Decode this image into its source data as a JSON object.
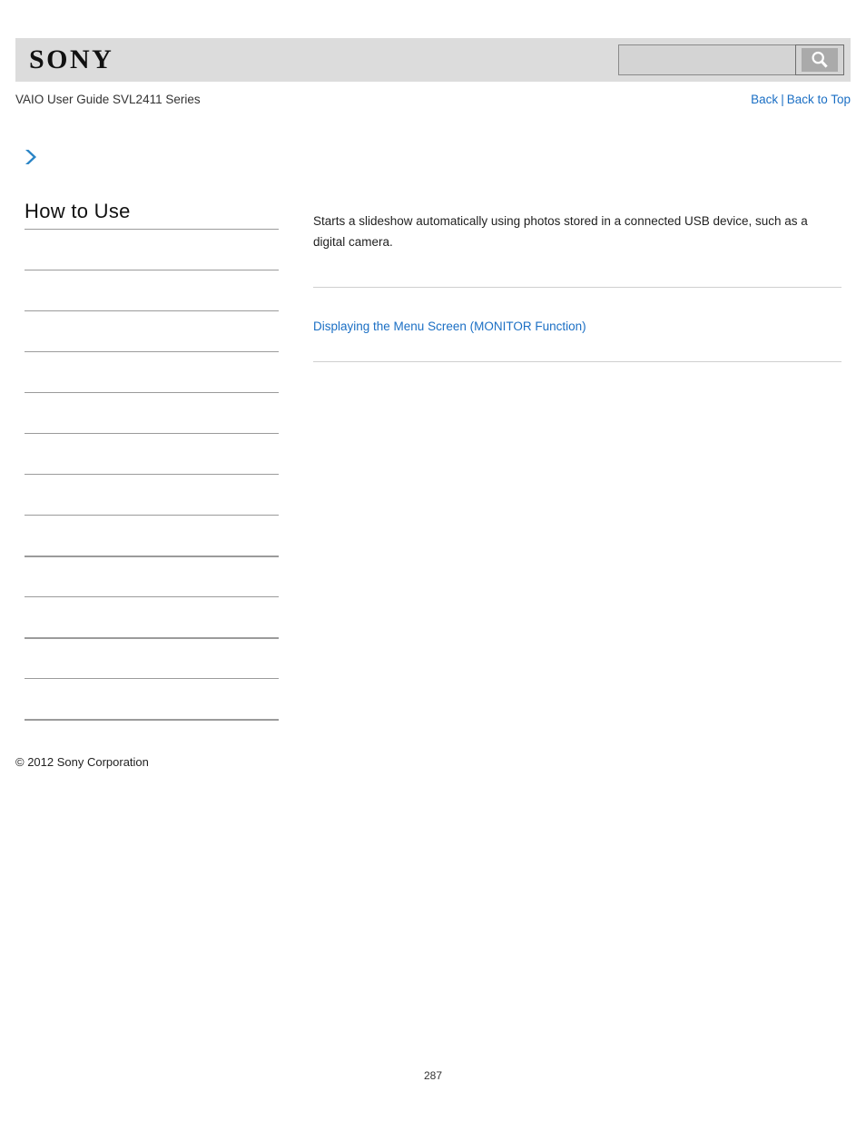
{
  "header": {
    "logo_text": "SONY",
    "logo_icon": "sony-wordmark",
    "search": {
      "value": "",
      "placeholder": "",
      "button_icon": "search-icon",
      "button_label": ""
    },
    "band_color": "#dcdcdc"
  },
  "subheader": {
    "guide_title": "VAIO User Guide SVL2411 Series",
    "back_label": "Back",
    "separator": "|",
    "back_to_top_label": "Back to Top",
    "link_color": "#1b6fc4"
  },
  "breadcrumb": {
    "arrow_icon": "chevron-right-icon",
    "arrow_color": "#2b85c6",
    "label": ""
  },
  "sidebar": {
    "title": "How to Use",
    "items": [
      {
        "label": "",
        "rule": "thin"
      },
      {
        "label": "",
        "rule": "thin"
      },
      {
        "label": "",
        "rule": "thin"
      },
      {
        "label": "",
        "rule": "thin"
      },
      {
        "label": "",
        "rule": "thin"
      },
      {
        "label": "",
        "rule": "thin"
      },
      {
        "label": "",
        "rule": "thin"
      },
      {
        "label": "",
        "rule": "thin"
      },
      {
        "label": "",
        "rule": "thick"
      },
      {
        "label": "",
        "rule": "thin"
      },
      {
        "label": "",
        "rule": "thick"
      },
      {
        "label": "",
        "rule": "thin"
      },
      {
        "label": "",
        "rule": "thick"
      }
    ],
    "copyright": "© 2012 Sony Corporation"
  },
  "main": {
    "body_text": "Starts a slideshow automatically using photos stored in a connected USB device, such as a digital camera.",
    "related_link": "Displaying the Menu Screen (MONITOR Function)",
    "link_color": "#1b6fc4",
    "rule_color": "#cfcfcf"
  },
  "footer": {
    "page_number": "287"
  }
}
